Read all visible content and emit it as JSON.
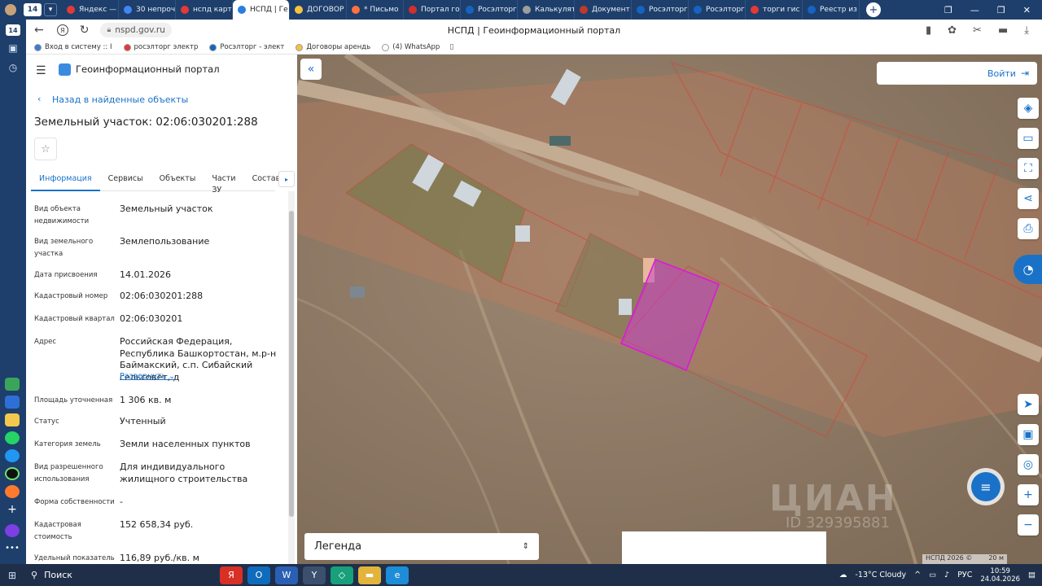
{
  "browser": {
    "tabs": [
      {
        "label": "Яндекс —",
        "color": "#e53935"
      },
      {
        "label": "30 непрочі",
        "color": "#4285f4"
      },
      {
        "label": "нспд карт",
        "color": "#e53935"
      },
      {
        "label": "НСПД | Ге",
        "color": "#2b7de0",
        "active": true
      },
      {
        "label": "ДОГОВОР",
        "color": "#f5c242"
      },
      {
        "label": "* Письмо",
        "color": "#ff7043"
      },
      {
        "label": "Портал го",
        "color": "#d32f2f"
      },
      {
        "label": "Росэлторг",
        "color": "#1565c0"
      },
      {
        "label": "Калькулят",
        "color": "#9e9e9e"
      },
      {
        "label": "Документ",
        "color": "#c0392b"
      },
      {
        "label": "Росэлторг",
        "color": "#1565c0"
      },
      {
        "label": "Росэлторг",
        "color": "#1565c0"
      },
      {
        "label": "торги гис",
        "color": "#e53935"
      },
      {
        "label": "Реестр из",
        "color": "#1565c0"
      }
    ],
    "tab_counter": "14",
    "url": "nspd.gov.ru",
    "page_title": "НСПД | Геоинформационный портал",
    "bookmarks": [
      {
        "label": "Вход в систему :: I"
      },
      {
        "label": "росэлторг электр"
      },
      {
        "label": "Росэлторг - элект"
      },
      {
        "label": "Договоры арендь"
      },
      {
        "label": "(4) WhatsApp"
      }
    ],
    "side_counter": "14"
  },
  "panel": {
    "portal_title": "Геоинформационный портал",
    "back_link": "Назад в найденные объекты",
    "object_title": "Земельный участок: 02:06:030201:288",
    "tabs": [
      "Информация",
      "Сервисы",
      "Объекты",
      "Части ЗУ",
      "Состав"
    ],
    "fields": [
      {
        "label": "Вид объекта недвижимости",
        "value": "Земельный участок"
      },
      {
        "label": "Вид земельного участка",
        "value": "Землепользование"
      },
      {
        "label": "Дата присвоения",
        "value": "14.01.2026"
      },
      {
        "label": "Кадастровый номер",
        "value": "02:06:030201:288"
      },
      {
        "label": "Кадастровый квартал",
        "value": "02:06:030201"
      },
      {
        "label": "Адрес",
        "value": "Российская Федерация, Республика Башкортостан, м.р-н Баймакский, с.п. Сибайский сельсовет, д"
      },
      {
        "label": "Площадь уточненная",
        "value": "1 306 кв. м"
      },
      {
        "label": "Статус",
        "value": "Учтенный"
      },
      {
        "label": "Категория земель",
        "value": "Земли населенных пунктов"
      },
      {
        "label": "Вид разрешенного использования",
        "value": "Для индивидуального жилищного строительства"
      },
      {
        "label": "Форма собственности",
        "value": "-"
      },
      {
        "label": "Кадастровая стоимость",
        "value": "152 658,34 руб."
      },
      {
        "label": "Удельный показатель",
        "value": "116,89 руб./кв. м"
      }
    ],
    "expand_link": "Развернуть"
  },
  "map": {
    "login_label": "Войти",
    "legend_label": "Легенда",
    "copyright": "НСПД 2026 ©",
    "scale_label": "20 м",
    "watermark": "ЦИАН",
    "watermark_id": "ID 329395881"
  },
  "taskbar": {
    "search_label": "Поиск",
    "weather": "-13°C  Cloudy",
    "lang": "РУС",
    "time": "10:59",
    "date": "24.04.2026"
  },
  "colors": {
    "accent": "#1a72c8",
    "parcel": "#d81bd8",
    "boundary": "#d24a3a"
  }
}
